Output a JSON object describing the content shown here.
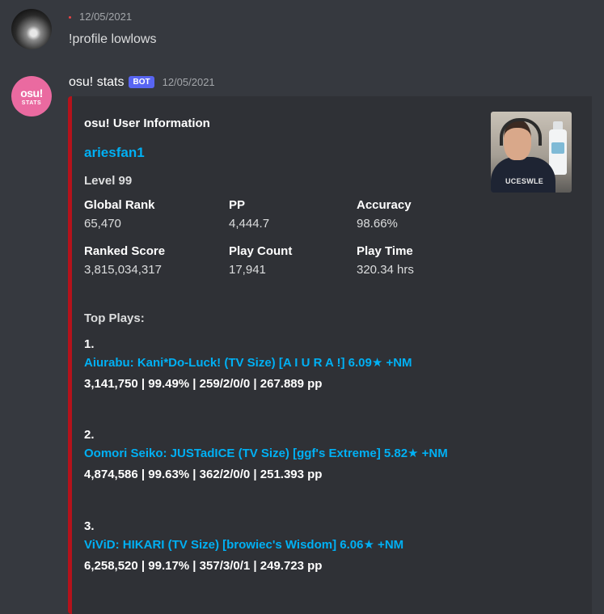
{
  "messages": [
    {
      "author": "",
      "timestamp": "12/05/2021",
      "text": "!profile lowlows"
    },
    {
      "author": "osu! stats",
      "bot_tag": "BOT",
      "timestamp": "12/05/2021",
      "avatar": {
        "line1": "osu!",
        "line2": "STATS"
      },
      "embed": {
        "accent_color": "#b5121b",
        "author": "osu! User Information",
        "title": "ariesfan1",
        "description": "Level 99",
        "thumbnail_shirt_text": "UCESWLE",
        "fields": [
          {
            "name": "Global Rank",
            "value": "65,470"
          },
          {
            "name": "PP",
            "value": "4,444.7"
          },
          {
            "name": "Accuracy",
            "value": "98.66%"
          },
          {
            "name": "Ranked Score",
            "value": "3,815,034,317"
          },
          {
            "name": "Play Count",
            "value": "17,941"
          },
          {
            "name": "Play Time",
            "value": "320.34 hrs"
          }
        ],
        "top_plays_title": "Top Plays:",
        "plays": [
          {
            "num": "1.",
            "title": "Aiurabu: Kani*Do-Luck! (TV Size) [A I U R A !] 6.09★ +NM",
            "stats": "3,141,750 | 99.49% | 259/2/0/0 |  267.889 pp"
          },
          {
            "num": "2.",
            "title": "Oomori Seiko: JUSTadICE (TV Size) [ggf's Extreme] 5.82★ +NM",
            "stats": "4,874,586 | 99.63% | 362/2/0/0 |  251.393 pp"
          },
          {
            "num": "3.",
            "title": "ViViD: HIKARI (TV Size) [browiec's Wisdom] 6.06★ +NM",
            "stats": "6,258,520 | 99.17% | 357/3/0/1 |  249.723 pp"
          }
        ]
      }
    }
  ],
  "colors": {
    "background": "#36393f",
    "embed_background": "#2f3136",
    "link": "#00b0f4",
    "bot_tag": "#5865f2",
    "bot_avatar": "#ea6aa0",
    "status_dot": "#ed4245"
  }
}
